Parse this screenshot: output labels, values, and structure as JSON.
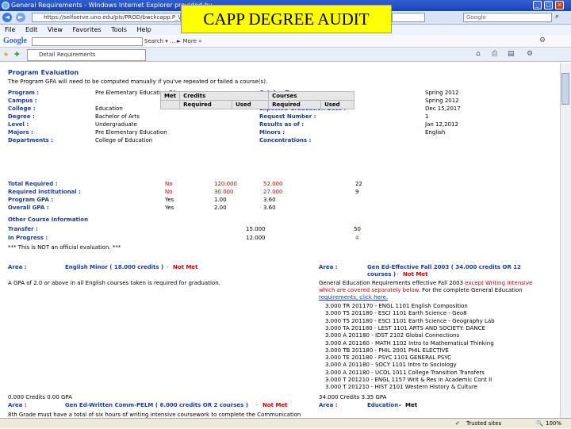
{
  "window": {
    "title": "General Requirements - Windows Internet Explorer provided by ..."
  },
  "overlay_title": "CAPP DEGREE AUDIT",
  "address": {
    "url": "https://selfserve.uno.edu/pls/PROD/bwckcapp.P_VerifyDisp...",
    "search_placeholder": "Google"
  },
  "menu": [
    "File",
    "Edit",
    "View",
    "Favorites",
    "Tools",
    "Help"
  ],
  "googlebar": {
    "logo": "Google",
    "tools": "Search ▾  ...  ► More »"
  },
  "tab": {
    "label": "Detail Requirements"
  },
  "audit": {
    "section_title": "Program Evaluation",
    "note": "The Program GPA will need to be computed manually if you've repeated or failed a course(s).",
    "left_labels": [
      "Program :",
      "Campus :",
      "College :",
      "Degree :",
      "Level :",
      "Majors :",
      "Departments :"
    ],
    "left_values": [
      "Pre Elementary Education BA",
      "",
      "Education",
      "Bachelor of Arts",
      "Undergraduate",
      "Pre Elementary Education",
      "College of Education"
    ],
    "right_labels": [
      "Catalog Term :",
      "Evaluation Term :",
      "Expected Graduation Date :",
      "Request Number :",
      "Results as of :",
      "Minors :",
      "Concentrations :"
    ],
    "right_values": [
      "Spring 2012",
      "Spring 2012",
      "Dec 15,2017",
      "1",
      "Jan 12,2012",
      "English",
      ""
    ],
    "table": {
      "met": "Met",
      "credits": "Credits",
      "courses": "Courses",
      "required": "Required",
      "used": "Used"
    },
    "rows": [
      {
        "label": "Total Required :",
        "met": "No",
        "cred_req": "120.000",
        "cred_used": "52.000",
        "crs_req": "",
        "crs_used": "22"
      },
      {
        "label": "Required Institutional :",
        "met": "No",
        "cred_req": "30.000",
        "cred_used": "27.000",
        "crs_req": "",
        "crs_used": "9"
      },
      {
        "label": "Program GPA :",
        "met": "Yes",
        "cred_req": "1.00",
        "cred_used": "3.60",
        "crs_req": "",
        "crs_used": ""
      },
      {
        "label": "Overall GPA :",
        "met": "Yes",
        "cred_req": "2.00",
        "cred_used": "3.60",
        "crs_req": "",
        "crs_used": ""
      }
    ],
    "other_info": "Other Course Information",
    "transfer_label": "Transfer :",
    "transfer_credits": "15.000",
    "transfer_courses": "50",
    "inprog_label": "In Progress :",
    "inprog_credits": "12.000",
    "inprog_courses": "4",
    "disclaimer": "*** This is NOT an official evaluation. ***",
    "area1": {
      "label": "Area :",
      "name": "English Minor ( 18.000 credits )",
      "status": "Not Met",
      "desc": "A GPA of 2.0 or above in all English courses taken is required for graduation."
    },
    "area2": {
      "label": "Area :",
      "name": "Gen Ed-Effective Fall 2003 ( 34.000 credits OR 12",
      "name2": "courses )",
      "status": "Not Met",
      "desc_pre": "General Education Requirements effective Fall 2003 ",
      "desc_red": "except Writing Intensive",
      "desc_line2_red": "which are covered separately below.",
      "desc_line2": " For the complete General Education",
      "desc_line3": "requirements, click here."
    },
    "courses": [
      "3.000 TR 201170 - ENGL 1101 English Composition",
      "3.000 T5 201180 - ESCI 1101 Earth Science - Geo8",
      "3.000 T5 201180 - ESCI 1101 Earth Science - Geography Lab",
      "3.000 TA 201180 - LEST 1101 ARTS AND SOCIETY: DANCE",
      "3.000 A 201180 - IDST 2102 Global Connections",
      "3.000 A 201160 - MATH 1102 Intro to Mathematical Thinking",
      "3.000 TB 201180 - PHIL 2001 PHIL ELECTIVE",
      "3.000 TE 201180 - PSYC 1101 GENERAL PSYC",
      "3.000 A 201180 - SOCY 1101 Intro to Sociology",
      "3.000 A 201180 - UCOL 1011 College Transition Transfers",
      "3.000 T 201210 - ENGL 1157 Writ & Res in Academic Cont II",
      "3.000 T 201210 - HIST 2101 Western History & Culture"
    ],
    "sum_left": "0.000 Credits    0.00 GPA",
    "sum_right": "34.000 Credits    3.35 GPA",
    "area3": {
      "label": "Area :",
      "name": "Gen Ed-Written Comm-PELM ( 6.000 credits OR 2 courses )",
      "status": "Not Met"
    },
    "area4": {
      "label": "Area :",
      "name": "Education",
      "status": "Met"
    },
    "bottom_text": "8th Grade must have a total of six hours of writing intensive coursework to complete the Communication"
  },
  "status": {
    "zone": "Trusted sites",
    "zoom": "100%"
  }
}
